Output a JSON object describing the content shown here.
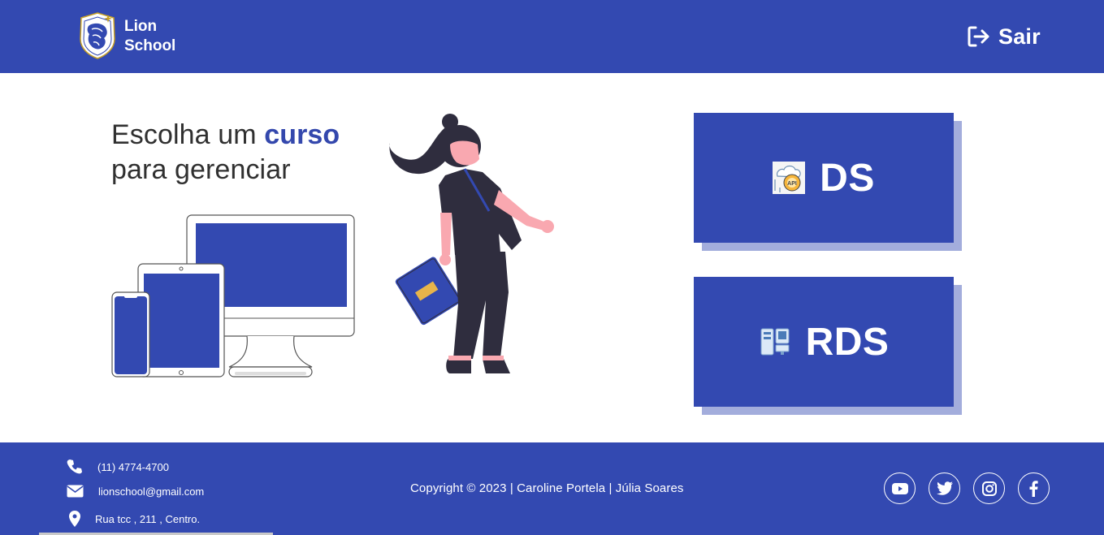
{
  "header": {
    "brand_line1": "Lion",
    "brand_line2": "School",
    "logout_label": "Sair"
  },
  "main": {
    "heading_part1": "Escolha um ",
    "heading_accent": "curso",
    "heading_line2": "para gerenciar",
    "courses": [
      {
        "label": "DS",
        "icon": "api-gear-icon"
      },
      {
        "label": "RDS",
        "icon": "servers-icon"
      }
    ]
  },
  "footer": {
    "phone": "(11) 4774-4700",
    "email": "lionschool@gmail.com",
    "address": "Rua tcc , 211 , Centro.",
    "copyright": "Copyright © 2023 | Caroline Portela | Júlia Soares",
    "socials": [
      "youtube-icon",
      "twitter-icon",
      "instagram-icon",
      "facebook-icon"
    ]
  },
  "colors": {
    "primary": "#3349b1",
    "text_dark": "#303030",
    "skin": "#f9a8b0",
    "dark_outfit": "#2f2d3e"
  }
}
